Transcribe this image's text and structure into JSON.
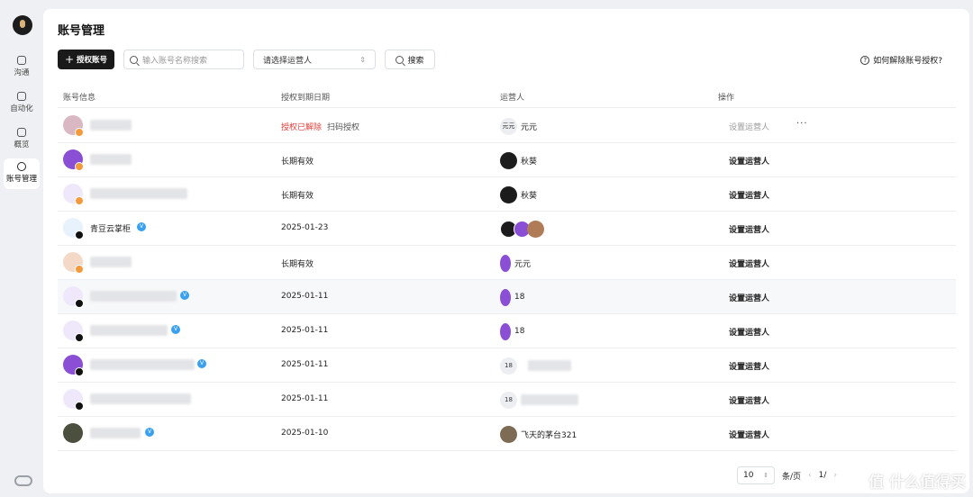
{
  "sidebar": {
    "items": [
      {
        "label": "沟通",
        "icon": "chat-icon"
      },
      {
        "label": "自动化",
        "icon": "robot-icon"
      },
      {
        "label": "概览",
        "icon": "grid-icon"
      },
      {
        "label": "账号管理",
        "icon": "account-icon",
        "active": true
      }
    ]
  },
  "page": {
    "title": "账号管理"
  },
  "toolbar": {
    "auth_button": "授权账号",
    "search_placeholder": "输入账号名称搜索",
    "operator_select": "请选择运营人",
    "search_button": "搜索",
    "help_link": "如何解除账号授权?"
  },
  "table": {
    "headers": [
      "账号信息",
      "授权到期日期",
      "运营人",
      "操作"
    ],
    "rows": [
      {
        "name": "",
        "expiry_status": "授权已解除",
        "expiry_action": "扫码授权",
        "operator": "元元",
        "operator_chip": "元元",
        "action": "设置运营人",
        "action_disabled": true,
        "more": "···"
      },
      {
        "name": "",
        "expiry": "长期有效",
        "operator": "秋葵",
        "action": "设置运营人"
      },
      {
        "name": "",
        "expiry": "长期有效",
        "operator": "秋葵",
        "action": "设置运营人"
      },
      {
        "name": "青豆云掌柜",
        "verified": "V",
        "expiry": "2025-01-23",
        "operator": "",
        "action": "设置运营人"
      },
      {
        "name": "",
        "expiry": "长期有效",
        "operator": "元元",
        "action": "设置运营人"
      },
      {
        "name": "",
        "verified": "V",
        "expiry": "2025-01-11",
        "operator": "18",
        "action": "设置运营人"
      },
      {
        "name": "",
        "verified": "V",
        "expiry": "2025-01-11",
        "operator": "18",
        "action": "设置运营人"
      },
      {
        "name": "",
        "verified": "V",
        "expiry": "2025-01-11",
        "operator_chip": "18",
        "action": "设置运营人"
      },
      {
        "name": "",
        "expiry": "2025-01-11",
        "operator_chip": "18",
        "action": "设置运营人"
      },
      {
        "name": "",
        "verified": "V",
        "expiry": "2025-01-10",
        "operator": "飞天的茅台321",
        "action": "设置运营人"
      }
    ]
  },
  "pagination": {
    "page_size": "10",
    "unit": "条/页",
    "prev": "‹",
    "current": "1/",
    "next": "›"
  },
  "watermark": "值 什么值得买",
  "colors": {
    "accent_red": "#e0403a",
    "verified_blue": "#3aa0f0",
    "badge_orange": "#f39a3c",
    "primary_button": "#1a1a1a"
  }
}
